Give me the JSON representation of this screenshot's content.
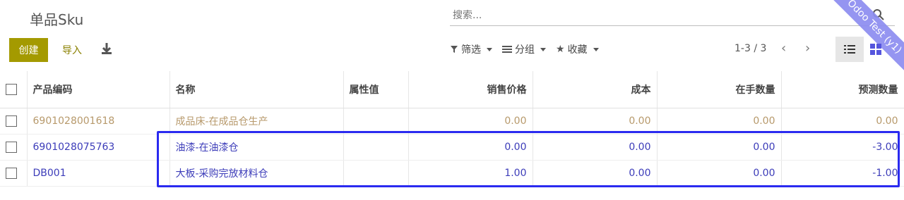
{
  "header": {
    "title": "单品Sku",
    "search_placeholder": "搜索...",
    "ribbon": "Odoo Test (y1)"
  },
  "toolbar": {
    "create_label": "创建",
    "import_label": "导入",
    "filter_label": "筛选",
    "group_label": "分组",
    "favorite_label": "收藏",
    "pager": "1-3 / 3"
  },
  "table": {
    "columns": [
      "产品编码",
      "名称",
      "属性值",
      "销售价格",
      "成本",
      "在手数量",
      "预测数量"
    ],
    "rows": [
      {
        "code": "6901028001618",
        "name": "成品床-在成品仓生产",
        "attr": "",
        "price": "0.00",
        "cost": "0.00",
        "onhand": "0.00",
        "forecast": "0.00"
      },
      {
        "code": "6901028075763",
        "name": "油漆-在油漆仓",
        "attr": "",
        "price": "0.00",
        "cost": "0.00",
        "onhand": "0.00",
        "forecast": "-3.00"
      },
      {
        "code": "DB001",
        "name": "大板-采购完放材料仓",
        "attr": "",
        "price": "1.00",
        "cost": "0.00",
        "onhand": "0.00",
        "forecast": "-1.00"
      }
    ]
  },
  "colors": {
    "create_button": "#a49a00",
    "link_blue": "#3c3cb9",
    "muted_row": "#b7996b",
    "highlight_border": "#2a2af0"
  }
}
